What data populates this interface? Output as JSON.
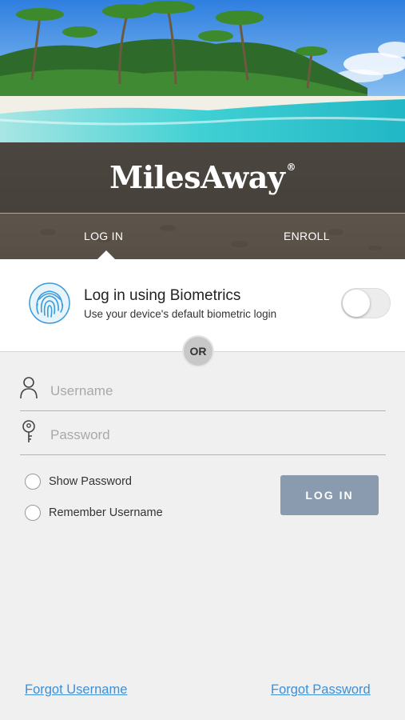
{
  "header": {
    "brand": "MilesAway",
    "registered_mark": "®",
    "tabs": [
      {
        "label": "LOG IN",
        "active": true
      },
      {
        "label": "ENROLL",
        "active": false
      }
    ]
  },
  "biometrics": {
    "title": "Log in using Biometrics",
    "subtitle": "Use your device's default biometric login",
    "enabled": false,
    "icon": "fingerprint-icon"
  },
  "separator": {
    "label": "OR"
  },
  "form": {
    "username": {
      "placeholder": "Username",
      "value": "",
      "icon": "user-icon"
    },
    "password": {
      "placeholder": "Password",
      "value": "",
      "icon": "key-icon"
    },
    "show_password": {
      "label": "Show Password",
      "checked": false
    },
    "remember_username": {
      "label": "Remember Username",
      "checked": false
    },
    "submit_label": "LOG IN"
  },
  "links": {
    "forgot_username": "Forgot Username",
    "forgot_password": "Forgot Password"
  },
  "colors": {
    "accent_link": "#3d8fd6",
    "button_bg": "#8a9bb0",
    "fingerprint": "#3b9ad9"
  }
}
